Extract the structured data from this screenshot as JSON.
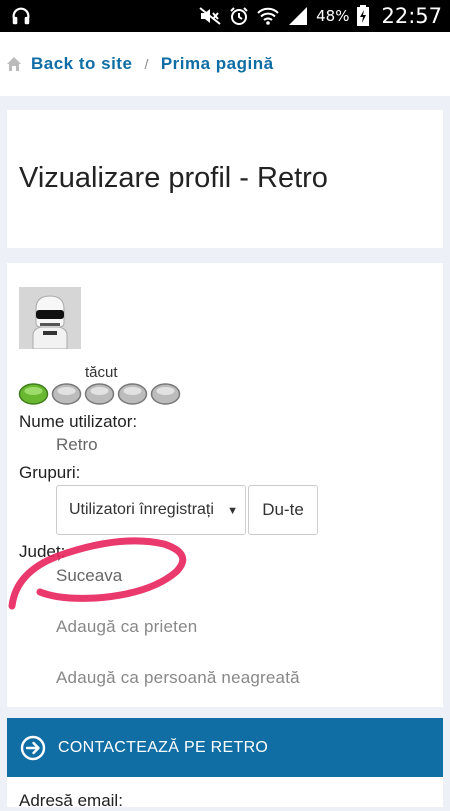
{
  "status_bar": {
    "battery_percent": "48%",
    "time": "22:57",
    "icons": [
      "headset-icon",
      "mute-icon",
      "alarm-icon",
      "wifi-icon",
      "signal-icon",
      "battery-charging-icon"
    ]
  },
  "breadcrumb": {
    "back_label": "Back to site",
    "separator": "/",
    "page_label": "Prima pagină"
  },
  "page": {
    "title": "Vizualizare profil - Retro"
  },
  "profile": {
    "rank_label": "tăcut",
    "stars_filled": 1,
    "stars_total": 5,
    "username_label": "Nume utilizator:",
    "username_value": "Retro",
    "groups_label": "Grupuri:",
    "groups_selected": "Utilizatori înregistrați",
    "go_label": "Du-te",
    "county_label": "Județ:",
    "county_value": "Suceava",
    "add_friend_label": "Adaugă ca prieten",
    "add_ignore_label": "Adaugă ca persoană neagreată"
  },
  "contact": {
    "label": "CONTACTEAZĂ PE RETRO"
  },
  "email": {
    "label": "Adresă email:"
  },
  "colors": {
    "link": "#0f6da6",
    "contact_bar": "#116ea5",
    "star_active": "#6ab832",
    "pen_mark": "#e8245c"
  }
}
